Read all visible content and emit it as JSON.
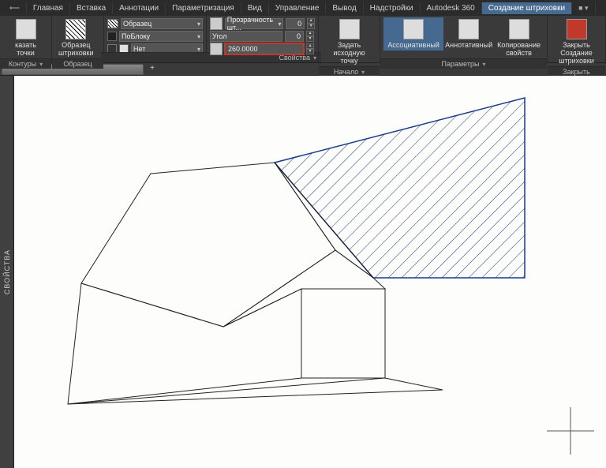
{
  "tabs": {
    "items": [
      "Главная",
      "Вставка",
      "Аннотации",
      "Параметризация",
      "Вид",
      "Управление",
      "Вывод",
      "Надстройки",
      "Autodesk 360"
    ],
    "active": "Создание штриховки",
    "extra": "■ ▾"
  },
  "ribbon": {
    "panel_contours": {
      "btn": "казать точки",
      "footer": "Контуры"
    },
    "panel_sample": {
      "btn": "Образец\nштриховки",
      "footer": "Образец"
    },
    "panel_props": {
      "row1_label": "Образец",
      "row2_label": "ПоБлоку",
      "row3_label": "Нет",
      "footer": "Свойства"
    },
    "panel_props2": {
      "row1_label": "Прозрачность шт...",
      "row1_val": "0",
      "row2_label": "Угол",
      "row2_val": "0",
      "row3_val": "260.0000"
    },
    "panel_origin": {
      "btn": "Задать\nисходную точку",
      "footer": "Начало"
    },
    "panel_assoc": {
      "btn": "Ассоциативный"
    },
    "panel_annot": {
      "btn": "Аннотативный"
    },
    "panel_copy": {
      "btn": "Копирование\nсвойств"
    },
    "panel_params_footer": "Параметры",
    "panel_close": {
      "btn": "Закрыть\nСоздание штриховки",
      "footer": "Закрыть"
    }
  },
  "side_label": "СВОЙСТВА"
}
